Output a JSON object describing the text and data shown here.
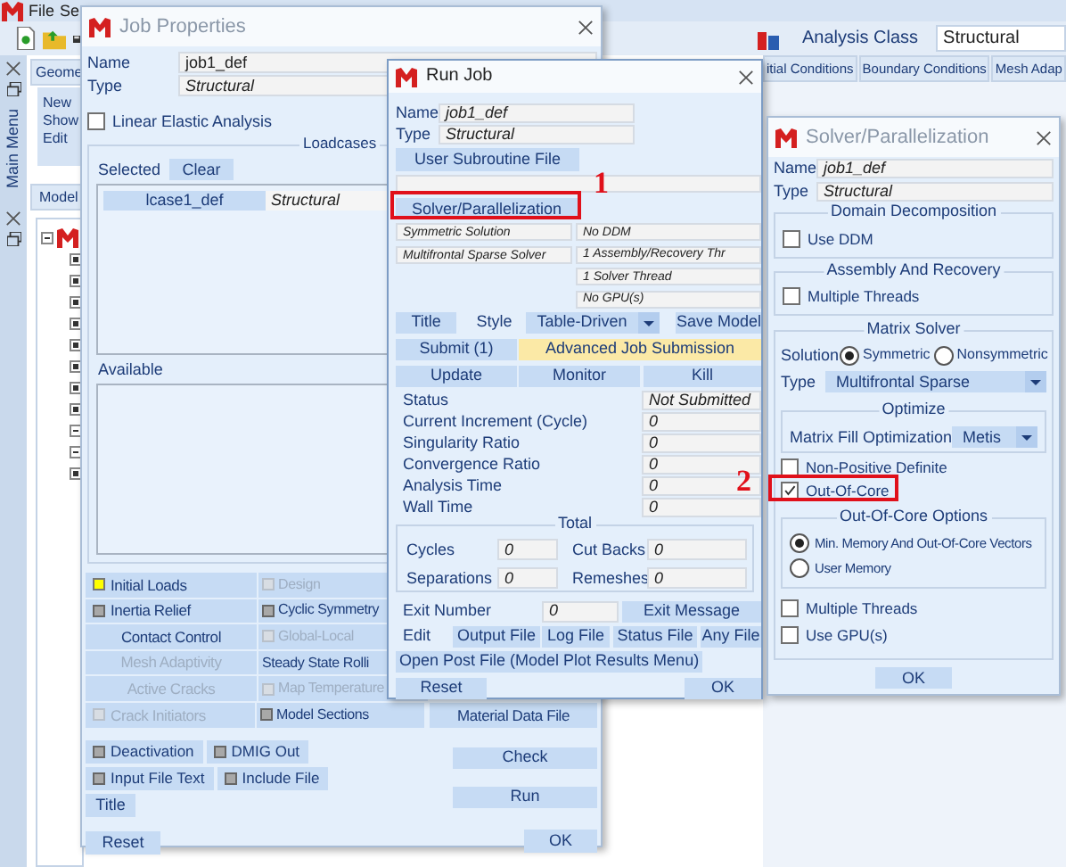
{
  "app": {
    "menu": [
      {
        "label": "File"
      },
      {
        "label": "Se"
      }
    ],
    "analysis_class": {
      "label": "Analysis Class",
      "value": "Structural"
    },
    "side_panel_title": "Main Menu",
    "geometry_tab": "Geome",
    "geometry_menu": [
      "New",
      "Show",
      "Edit"
    ],
    "model_tab": "Model",
    "tree": [
      {
        "expanded": true,
        "children": [
          {
            "expanded": false
          },
          {
            "expanded": false
          },
          {
            "expanded": false
          },
          {
            "expanded": false
          },
          {
            "expanded": false
          },
          {
            "expanded": false
          },
          {
            "expanded": false
          },
          {
            "expanded": false
          },
          {
            "expanded": true
          },
          {
            "expanded": true
          },
          {
            "expanded": false
          }
        ]
      }
    ],
    "tabs": [
      {
        "label": "itial Conditions",
        "selected": false
      },
      {
        "label": "Boundary Conditions",
        "selected": false
      },
      {
        "label": "Mesh Adap",
        "selected": false
      }
    ]
  },
  "job_properties": {
    "title": "Job Properties",
    "name_label": "Name",
    "name": "job1_def",
    "type_label": "Type",
    "type": "Structural",
    "linear_elastic": {
      "label": "Linear Elastic Analysis",
      "checked": false
    },
    "loadcases": {
      "title": "Loadcases",
      "selected_label": "Selected",
      "clear": "Clear",
      "selected": [
        {
          "name": "lcase1_def",
          "type": "Structural"
        }
      ],
      "available_label": "Available"
    },
    "option_rows": [
      [
        {
          "kind": "toggle",
          "label": "Initial Loads",
          "on": true,
          "disabled": false
        },
        {
          "kind": "toggle",
          "label": "Design",
          "on": false,
          "disabled": true
        }
      ],
      [
        {
          "kind": "toggle",
          "label": "Inertia Relief",
          "on": false,
          "disabled": false
        },
        {
          "kind": "toggle",
          "label": "Cyclic Symmetry",
          "on": false,
          "disabled": false
        }
      ],
      [
        {
          "kind": "button",
          "label": "Contact Control",
          "disabled": false
        },
        {
          "kind": "toggle",
          "label": "Global-Local",
          "on": false,
          "disabled": true
        }
      ],
      [
        {
          "kind": "button",
          "label": "Mesh Adaptivity",
          "disabled": true
        },
        {
          "kind": "button",
          "label": "Steady State Rolli",
          "disabled": false
        }
      ],
      [
        {
          "kind": "button",
          "label": "Active Cracks",
          "disabled": true
        },
        {
          "kind": "toggle",
          "label": "Map Temperature",
          "on": false,
          "disabled": true
        }
      ],
      [
        {
          "kind": "toggle",
          "label": "Crack Initiators",
          "on": false,
          "disabled": true
        },
        {
          "kind": "toggle",
          "label": "Model Sections",
          "on": false,
          "disabled": false
        },
        {
          "kind": "button",
          "label": "Material Data File",
          "disabled": false
        }
      ]
    ],
    "extra_rows": [
      [
        {
          "label": "Deactivation",
          "on": false
        },
        {
          "label": "DMIG Out",
          "on": false
        }
      ],
      [
        {
          "label": "Input File Text",
          "on": false
        },
        {
          "label": "Include File",
          "on": false
        }
      ]
    ],
    "title_button": "Title",
    "reset": "Reset",
    "check": "Check",
    "run": "Run",
    "ok": "OK"
  },
  "run_job": {
    "title": "Run Job",
    "name_label": "Name",
    "name": "job1_def",
    "type_label": "Type",
    "type": "Structural",
    "user_subroutine": "User Subroutine File",
    "solver_button": "Solver/Parallelization",
    "solver_summary": [
      "Symmetric Solution",
      "Multifrontal Sparse Solver"
    ],
    "parallel_summary": [
      "No DDM",
      "1 Assembly/Recovery Thr",
      "1 Solver Thread",
      "No GPU(s)"
    ],
    "title_button": "Title",
    "style_label": "Style",
    "style": "Table-Driven",
    "save_model": "Save Model",
    "submit": "Submit (1)",
    "advanced": "Advanced Job Submission",
    "update": "Update",
    "monitor": "Monitor",
    "kill": "Kill",
    "status": [
      {
        "label": "Status",
        "value": "Not Submitted"
      },
      {
        "label": "Current Increment (Cycle)",
        "value": "0"
      },
      {
        "label": "Singularity Ratio",
        "value": "0"
      },
      {
        "label": "Convergence Ratio",
        "value": "0"
      },
      {
        "label": "Analysis Time",
        "value": "0"
      },
      {
        "label": "Wall Time",
        "value": "0"
      }
    ],
    "total": {
      "title": "Total",
      "items": [
        {
          "label": "Cycles",
          "value": "0"
        },
        {
          "label": "Cut Backs",
          "value": "0"
        },
        {
          "label": "Separations",
          "value": "0"
        },
        {
          "label": "Remeshes",
          "value": "0"
        }
      ]
    },
    "exit_number_label": "Exit Number",
    "exit_number": "0",
    "exit_message": "Exit Message",
    "edit_label": "Edit",
    "edit_buttons": [
      "Output File",
      "Log File",
      "Status File",
      "Any File"
    ],
    "open_post": "Open Post File (Model Plot Results Menu)",
    "reset": "Reset",
    "ok": "OK"
  },
  "solver": {
    "title": "Solver/Parallelization",
    "name_label": "Name",
    "name": "job1_def",
    "type_label": "Type",
    "type": "Structural",
    "domain": {
      "title": "Domain Decomposition",
      "use_ddm": {
        "label": "Use DDM",
        "checked": false
      }
    },
    "assembly": {
      "title": "Assembly And Recovery",
      "multiple_threads": {
        "label": "Multiple Threads",
        "checked": false
      }
    },
    "matrix": {
      "title": "Matrix Solver",
      "solution_label": "Solution",
      "solutions": [
        {
          "label": "Symmetric",
          "selected": true
        },
        {
          "label": "Nonsymmetric",
          "selected": false
        }
      ],
      "type_label": "Type",
      "type": "Multifrontal Sparse",
      "optimize": {
        "title": "Optimize",
        "label": "Matrix Fill Optimization",
        "value": "Metis"
      },
      "non_positive_definite": {
        "label": "Non-Positive Definite",
        "checked": false
      },
      "out_of_core": {
        "label": "Out-Of-Core",
        "checked": true
      },
      "ooc_options": {
        "title": "Out-Of-Core Options",
        "choices": [
          {
            "label": "Min. Memory And Out-Of-Core Vectors",
            "selected": true
          },
          {
            "label": "User Memory",
            "selected": false
          }
        ]
      },
      "multiple_threads": {
        "label": "Multiple Threads",
        "checked": false
      },
      "use_gpu": {
        "label": "Use GPU(s)",
        "checked": false
      }
    },
    "ok": "OK"
  },
  "annotations": [
    {
      "label": "1"
    },
    {
      "label": "2"
    }
  ]
}
